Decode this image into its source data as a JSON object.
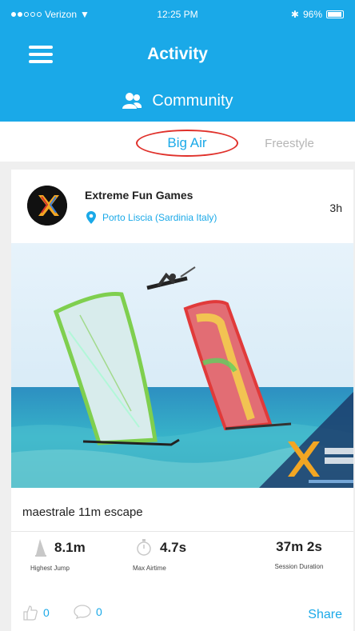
{
  "status_bar": {
    "carrier": "Verizon",
    "time": "12:25 PM",
    "battery_percent": "96%"
  },
  "header": {
    "title": "Activity",
    "subtitle": "Community"
  },
  "tabs": [
    {
      "label": "Big Air",
      "active": true
    },
    {
      "label": "Freestyle",
      "active": false
    }
  ],
  "post": {
    "username": "Extreme Fun Games",
    "location": "Porto Liscia (Sardinia Italy)",
    "time_ago": "3h",
    "session_title": "maestrale 11m escape",
    "stats": [
      {
        "value": "8.1m",
        "label": "Highest Jump",
        "icon": "sail-icon"
      },
      {
        "value": "4.7s",
        "label": "Max Airtime",
        "icon": "stopwatch-icon"
      },
      {
        "value": "37m 2s",
        "label": "Session Duration",
        "icon": ""
      }
    ],
    "likes": "0",
    "comments": "0",
    "share_label": "Share"
  },
  "colors": {
    "brand": "#1aa9e8",
    "tab_highlight": "#e0312b"
  }
}
